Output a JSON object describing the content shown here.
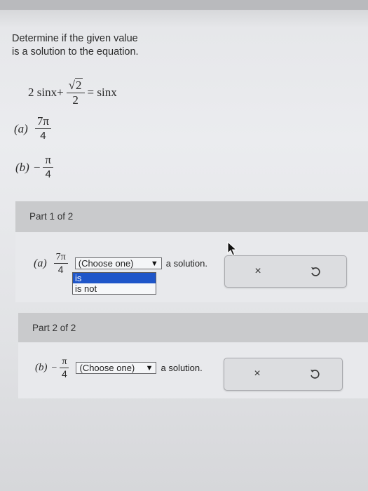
{
  "question": {
    "prompt": "Determine if the given value is a solution to the equation.",
    "equation": {
      "lhs_prefix": "2 sinx+",
      "sqrt_num": "2",
      "den": "2",
      "rhs": "= sinx"
    },
    "items": [
      {
        "label": "(a)",
        "sign": "",
        "num": "7π",
        "den": "4"
      },
      {
        "label": "(b)",
        "sign": "−",
        "num": "π",
        "den": "4"
      }
    ]
  },
  "parts": [
    {
      "header": "Part 1 of 2",
      "label": "(a)",
      "sign": "",
      "num": "7π",
      "den": "4",
      "select_value": "(Choose one)",
      "after_text": "a solution.",
      "dropdown_open": true,
      "options": [
        "is",
        "is not"
      ],
      "highlighted_option": "is"
    },
    {
      "header": "Part 2 of 2",
      "label": "(b)",
      "sign": "−",
      "num": "π",
      "den": "4",
      "select_value": "(Choose one)",
      "after_text": "a solution.",
      "dropdown_open": false
    }
  ],
  "icons": {
    "dropdown_arrow": "▼",
    "clear": "×",
    "undo": "undo-icon",
    "cursor": "mouse-pointer-icon"
  },
  "colors": {
    "highlight": "#1f56c9",
    "header_bg": "#c9cacc",
    "body_bg": "#e8e9ec"
  }
}
